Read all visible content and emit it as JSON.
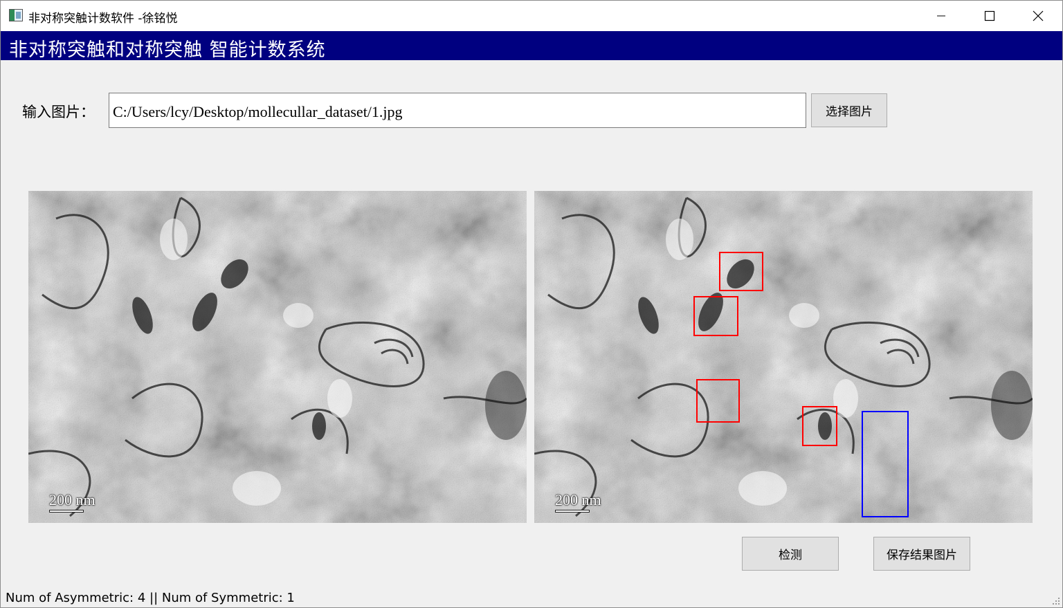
{
  "window": {
    "title": "非对称突触计数软件 -徐铭悦",
    "icon": "app-window-icon"
  },
  "header": {
    "title": "非对称突触和对称突触 智能计数系统",
    "background_color": "#000080",
    "text_color": "#ffffff"
  },
  "input": {
    "label": "输入图片：",
    "value": "C:/Users/lcy/Desktop/mollecullar_dataset/1.jpg",
    "select_button": "选择图片"
  },
  "images": {
    "original": {
      "description_icon": "electron-micrograph",
      "scale_label": "200 nm"
    },
    "result": {
      "description_icon": "electron-micrograph-with-detections",
      "scale_label": "200 nm",
      "detections": [
        {
          "type": "asymmetric",
          "color": "#ff0000"
        },
        {
          "type": "asymmetric",
          "color": "#ff0000"
        },
        {
          "type": "asymmetric",
          "color": "#ff0000"
        },
        {
          "type": "asymmetric",
          "color": "#ff0000"
        },
        {
          "type": "symmetric",
          "color": "#0000ff"
        }
      ]
    }
  },
  "actions": {
    "detect_button": "检测",
    "save_button": "保存结果图片"
  },
  "status": {
    "text": "Num of Asymmetric: 4  ||  Num of Symmetric: 1"
  }
}
